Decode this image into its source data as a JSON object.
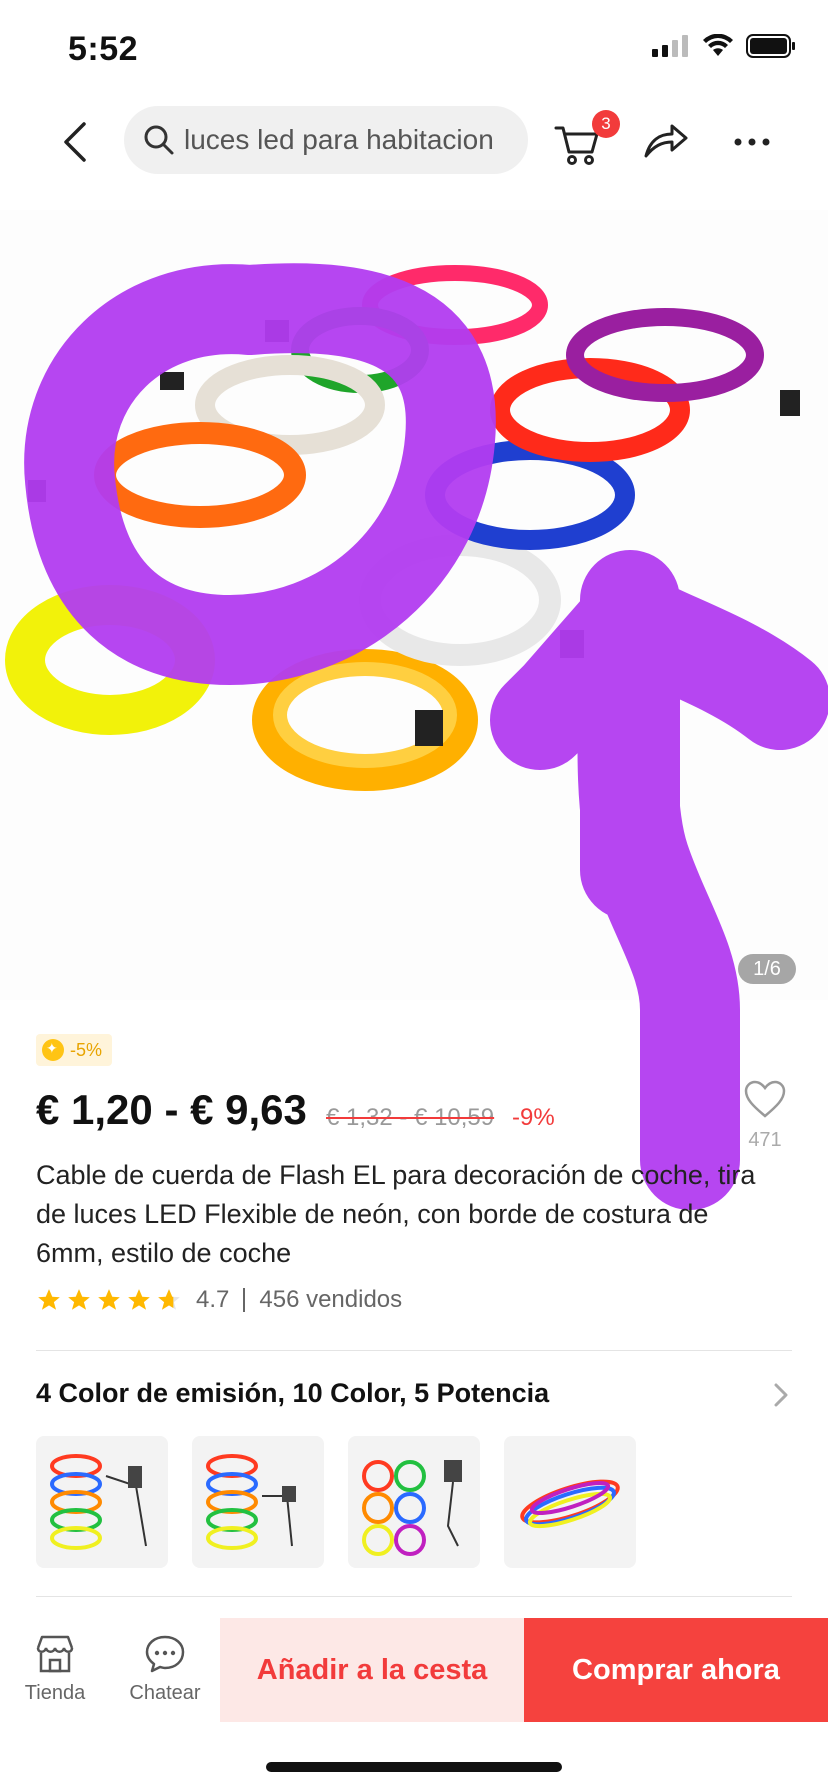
{
  "status_bar": {
    "time": "5:52"
  },
  "search": {
    "query": "luces led para habitacion"
  },
  "cart": {
    "badge_count": "3"
  },
  "gallery": {
    "counter": "1/6"
  },
  "promo": {
    "coin_discount": "-5%"
  },
  "price": {
    "current": "€ 1,20 - € 9,63",
    "original": "€ 1,32 - € 10,59",
    "discount": "-9%"
  },
  "wishlist": {
    "count": "471"
  },
  "product": {
    "title": "Cable de cuerda de Flash EL para decoración de coche, tira de luces LED Flexible de neón, con borde de costura de 6mm, estilo de coche",
    "rating": "4.7",
    "rating_stars": 4.7,
    "sold": "456 vendidos"
  },
  "variants": {
    "title": "4 Color de emisión, 10 Color, 5 Potencia"
  },
  "bottom_bar": {
    "store_label": "Tienda",
    "chat_label": "Chatear",
    "add_to_cart_label": "Añadir a la cesta",
    "buy_now_label": "Comprar ahora"
  },
  "colors": {
    "accent_red": "#f23b3b",
    "annotation_purple": "#b23cf0"
  },
  "icons": [
    "back-icon",
    "search-icon",
    "cart-icon",
    "share-icon",
    "more-icon",
    "heart-icon",
    "store-icon",
    "chat-icon",
    "chevron-right-icon",
    "star-icon"
  ]
}
